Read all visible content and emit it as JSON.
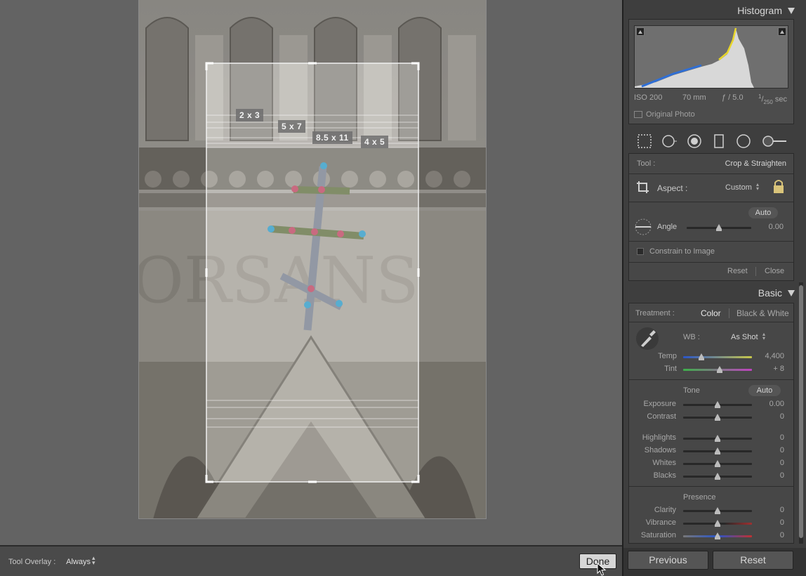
{
  "canvas": {
    "ratio_labels": [
      "2 x 3",
      "5 x 7",
      "8.5 x 11",
      "4 x 5"
    ]
  },
  "toolbar": {
    "overlay_label": "Tool Overlay :",
    "overlay_value": "Always",
    "done_label": "Done"
  },
  "histogram": {
    "title": "Histogram",
    "iso": "ISO 200",
    "focal": "70 mm",
    "aperture": "ƒ / 5.0",
    "shutter_num": "1",
    "shutter_den": "250",
    "shutter_unit": " sec",
    "original_photo_label": "Original Photo"
  },
  "crop": {
    "tool_label": "Tool :",
    "tool_value": "Crop & Straighten",
    "aspect_label": "Aspect :",
    "aspect_value": "Custom",
    "auto_label": "Auto",
    "angle_label": "Angle",
    "angle_value": "0.00",
    "angle_level": 0.5,
    "constrain_label": "Constrain to Image",
    "reset_label": "Reset",
    "close_label": "Close"
  },
  "basic": {
    "title": "Basic",
    "treatment_label": "Treatment :",
    "treatment_color": "Color",
    "treatment_bw": "Black & White",
    "wb_label": "WB :",
    "wb_value": "As Shot",
    "temp": {
      "label": "Temp",
      "value": "4,400",
      "level": 0.27
    },
    "tint": {
      "label": "Tint",
      "value": "+ 8",
      "level": 0.53
    },
    "tone_label": "Tone",
    "tone_auto": "Auto",
    "tone": [
      {
        "label": "Exposure",
        "value": "0.00",
        "level": 0.5
      },
      {
        "label": "Contrast",
        "value": "0",
        "level": 0.5
      }
    ],
    "tone2": [
      {
        "label": "Highlights",
        "value": "0",
        "level": 0.5
      },
      {
        "label": "Shadows",
        "value": "0",
        "level": 0.5
      },
      {
        "label": "Whites",
        "value": "0",
        "level": 0.5
      },
      {
        "label": "Blacks",
        "value": "0",
        "level": 0.5
      }
    ],
    "presence_label": "Presence",
    "presence": [
      {
        "label": "Clarity",
        "value": "0",
        "level": 0.5
      },
      {
        "label": "Vibrance",
        "value": "0",
        "level": 0.5
      },
      {
        "label": "Saturation",
        "value": "0",
        "level": 0.5
      }
    ]
  },
  "nav": {
    "previous_label": "Previous",
    "reset_label": "Reset"
  },
  "colors": {
    "panel_bg": "#3e3e3e",
    "canvas_bg": "#636363"
  }
}
